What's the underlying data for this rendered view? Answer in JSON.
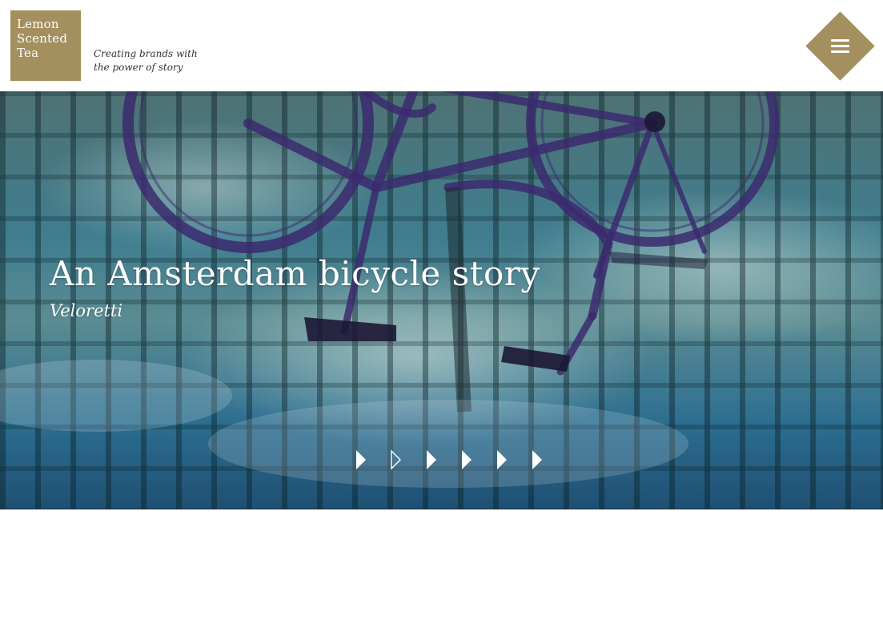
{
  "brand": {
    "logo_lines": [
      "Lemon",
      "Scented",
      "Tea"
    ],
    "tagline_lines": [
      "Creating brands with",
      "the power of story"
    ],
    "color": "#a48f5e"
  },
  "menu": {
    "icon": "hamburger-menu-icon"
  },
  "hero": {
    "title": "An Amsterdam bicycle story",
    "subtitle": "Veloretti"
  },
  "slider": {
    "count": 6,
    "active_index": 1,
    "icon": "play-triangle-icon"
  }
}
